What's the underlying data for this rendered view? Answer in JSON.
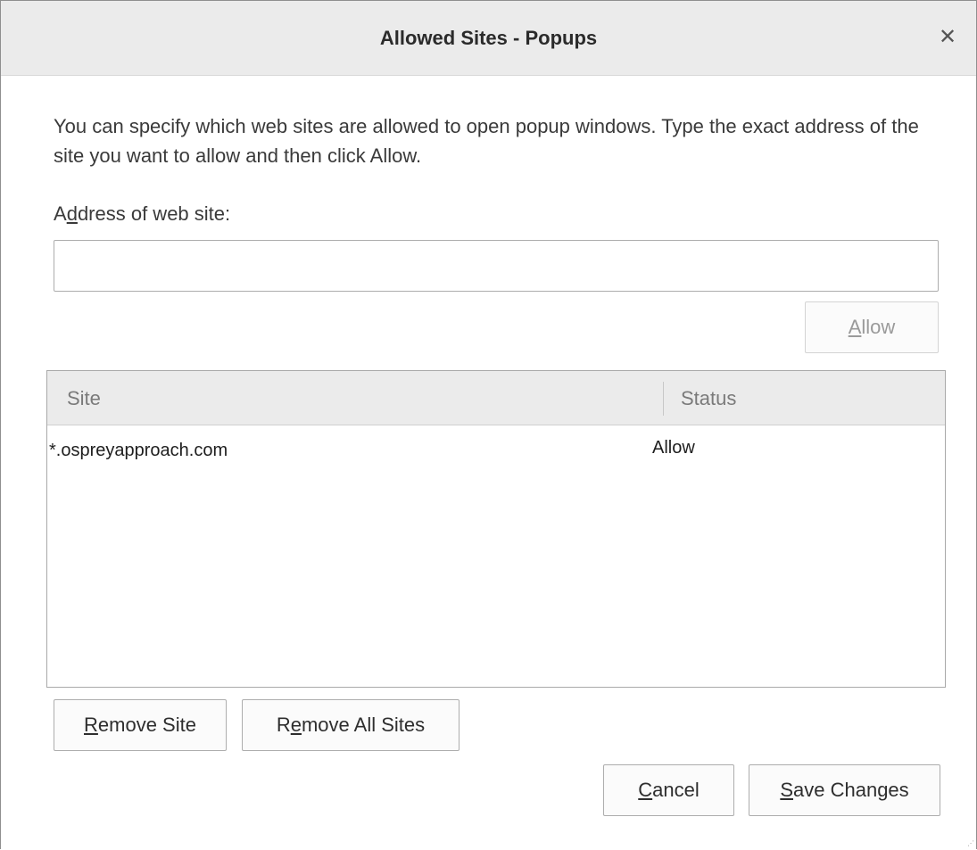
{
  "dialog": {
    "title": "Allowed Sites - Popups",
    "close_icon": "close-icon"
  },
  "description": "You can specify which web sites are allowed to open popup windows. Type the exact address of the site you want to allow and then click Allow.",
  "address": {
    "label_prefix": "A",
    "label_mnemonic": "d",
    "label_suffix": "dress of web site:",
    "value": "",
    "placeholder": ""
  },
  "allow_button": {
    "mnemonic": "A",
    "rest": "llow",
    "enabled": false
  },
  "table": {
    "columns": [
      "Site",
      "Status"
    ],
    "rows": [
      {
        "site": "*.ospreyapproach.com",
        "status": "Allow"
      }
    ]
  },
  "buttons": {
    "remove_site": {
      "mnemonic": "R",
      "rest": "emove Site"
    },
    "remove_all": {
      "prefix": "R",
      "mnemonic": "e",
      "rest": "move All Sites"
    },
    "cancel": {
      "mnemonic": "C",
      "rest": "ancel"
    },
    "save": {
      "mnemonic": "S",
      "rest": "ave Changes"
    }
  }
}
